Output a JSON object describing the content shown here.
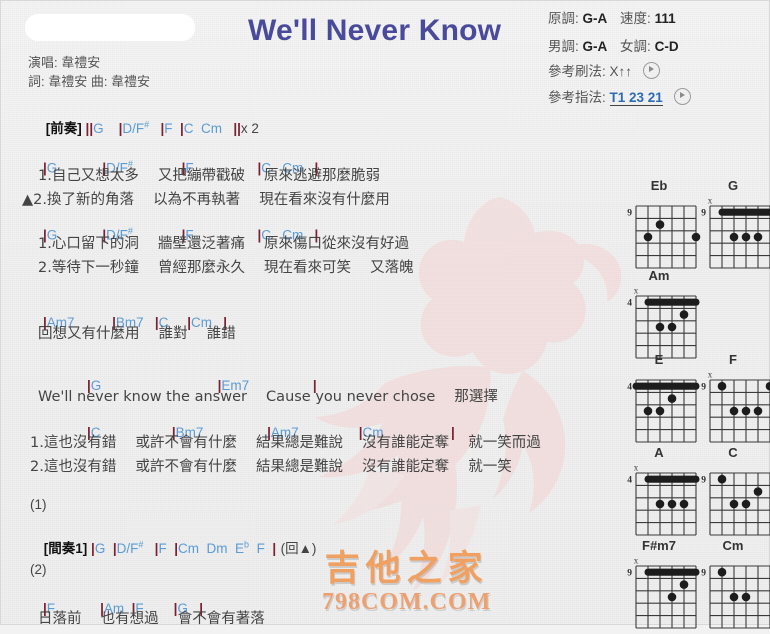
{
  "header": {
    "title": "We'll Never Know",
    "search_placeholder": "",
    "search_value": "",
    "singer_line": "演唱: 韋禮安",
    "credit_line": "詞: 韋禮安   曲: 韋禮安"
  },
  "info": {
    "orig_key_label": "原調:",
    "orig_key_value": "G-A",
    "tempo_label": "速度:",
    "tempo_value": "111",
    "male_key_label": "男調:",
    "male_key_value": "G-A",
    "female_key_label": "女調:",
    "female_key_value": "C-D",
    "strum_label": "參考刷法:",
    "strum_value": "X↑↑",
    "finger_label": "參考指法:",
    "finger_value": "T1 23 21",
    "play_icon": "play-icon"
  },
  "sections": [
    {
      "id": "intro",
      "tag": "[前奏]",
      "chords": "||G    |D/F#    |F    |C    Cm    || x 2"
    }
  ],
  "lines": {
    "intro_tag": "[前奏]",
    "intro_chords_a": "||",
    "intro_G": "G",
    "intro_bar1": "|",
    "intro_DF": "D/F",
    "intro_sharp": "#",
    "intro_bar2": "|",
    "intro_F": "F",
    "intro_bar3": "|",
    "intro_C": "C",
    "intro_Cm": "Cm",
    "intro_end": "||",
    "intro_x2": "x 2",
    "v1_chord_G": "G",
    "v1_chord_DF": "D/F",
    "v1_chord_F": "F",
    "v1_chord_C": "C",
    "v1_chord_Cm": "Cm",
    "v1_lyric_1": "1.自己又想太多　 又把繃帶戳破　 原來逃避那麼脆弱",
    "v1_lyric_2": "▲2.換了新的角落　 以為不再執著　 現在看來沒有什麼用",
    "v2_lyric_1": "1.心口留下的洞　 牆壁還泛著痛　 原來傷口從來沒有好過",
    "v2_lyric_2": "2.等待下一秒鐘　 曾經那麼永久　 現在看來可笑　 又落魄",
    "b1_chord_Am7": "Am7",
    "b1_chord_Bm7": "Bm7",
    "b1_chord_C": "C",
    "b1_chord_Cm": "Cm",
    "b1_lyric": "回想又有什麼用　 誰對　 誰錯",
    "c0_chord_G": "G",
    "c0_chord_Em7": "Em7",
    "c0_lyric": "We'll never know the answer　 Cause you never chose　 那選擇",
    "c1_chord_C": "C",
    "c1_chord_Bm7": "Bm7",
    "c1_chord_Am7": "Am7",
    "c1_chord_Cm": "Cm",
    "c1_lyric_1": "1.這也沒有錯　 或許不會有什麼　 結果總是難說　 沒有誰能定奪　 就一笑而過",
    "c1_lyric_2": "2.這也沒有錯　 或許不會有什麼　 結果總是難說　 沒有誰能定奪　 就一笑",
    "ending1_num": "(1)",
    "interlude_tag": "[間奏1]",
    "i_G": "G",
    "i_DF": "D/F",
    "i_sharp": "#",
    "i_F": "F",
    "i_Cm": "Cm",
    "i_Dm": "Dm",
    "i_E": "E",
    "i_flat": "b",
    "i_F2": "F",
    "i_repeat": "(回▲)",
    "ending2_num": "(2)",
    "e2_chord_F": "F",
    "e2_chord_Am": "Am",
    "e2_chord_F2": "F",
    "e2_chord_G": "G",
    "e2_lyric": "日落前　 也有想過　 會不會有著落",
    "bar": "|"
  },
  "watermark": {
    "cn": "吉他之家",
    "en": "798COM.COM",
    "color": "#f0a060"
  },
  "colors": {
    "title": "#4a4a9c",
    "chord": "#5b9bd5",
    "barline": "#7b2030",
    "lyric": "#444444",
    "watermark": "#f0a060"
  },
  "chord_diagrams": [
    {
      "name": "Eb",
      "base_fret": "9",
      "show_base": true,
      "markers": [
        "",
        "",
        "",
        "",
        "",
        ""
      ],
      "dots": [
        {
          "string": 5,
          "fret": 3
        },
        {
          "string": 4,
          "fret": 2
        },
        {
          "string": 1,
          "fret": 3
        }
      ],
      "barre": null
    },
    {
      "name": "G",
      "base_fret": "9",
      "show_base": true,
      "markers": [
        "x",
        "",
        "",
        "",
        "",
        ""
      ],
      "dots": [
        {
          "string": 4,
          "fret": 3
        },
        {
          "string": 3,
          "fret": 3
        },
        {
          "string": 2,
          "fret": 3
        }
      ],
      "barre": {
        "fret": 1,
        "from": 5,
        "to": 1
      }
    },
    {
      "name": "Am",
      "base_fret": "4",
      "show_base": true,
      "markers": [
        "x",
        "",
        "",
        "",
        "",
        ""
      ],
      "dots": [
        {
          "string": 2,
          "fret": 2
        },
        {
          "string": 4,
          "fret": 3
        },
        {
          "string": 3,
          "fret": 3
        }
      ],
      "barre": {
        "fret": 1,
        "from": 5,
        "to": 1
      }
    },
    {
      "name": "E",
      "base_fret": "4",
      "show_base": true,
      "markers": [
        "",
        "",
        "",
        "",
        "",
        ""
      ],
      "dots": [
        {
          "string": 3,
          "fret": 2
        },
        {
          "string": 5,
          "fret": 3
        },
        {
          "string": 4,
          "fret": 3
        }
      ],
      "barre": {
        "fret": 1,
        "from": 6,
        "to": 1
      }
    },
    {
      "name": "F",
      "base_fret": "9",
      "show_base": true,
      "markers": [
        "x",
        "",
        "",
        "",
        "",
        ""
      ],
      "dots": [
        {
          "string": 5,
          "fret": 1
        },
        {
          "string": 1,
          "fret": 1
        },
        {
          "string": 4,
          "fret": 3
        },
        {
          "string": 3,
          "fret": 3
        },
        {
          "string": 2,
          "fret": 3
        }
      ],
      "barre": null
    },
    {
      "name": "A",
      "base_fret": "4",
      "show_base": true,
      "markers": [
        "x",
        "",
        "",
        "",
        "",
        ""
      ],
      "dots": [
        {
          "string": 4,
          "fret": 3
        },
        {
          "string": 3,
          "fret": 3
        },
        {
          "string": 2,
          "fret": 3
        }
      ],
      "barre": {
        "fret": 1,
        "from": 5,
        "to": 1
      }
    },
    {
      "name": "C",
      "base_fret": "9",
      "show_base": true,
      "markers": [
        "",
        "",
        "",
        "",
        "",
        ""
      ],
      "dots": [
        {
          "string": 5,
          "fret": 1
        },
        {
          "string": 2,
          "fret": 2
        },
        {
          "string": 4,
          "fret": 3
        },
        {
          "string": 3,
          "fret": 3
        }
      ],
      "barre": null
    },
    {
      "name": "F#m7",
      "base_fret": "9",
      "show_base": true,
      "markers": [
        "x",
        "",
        "",
        "",
        "",
        ""
      ],
      "dots": [
        {
          "string": 3,
          "fret": 3
        },
        {
          "string": 2,
          "fret": 2
        }
      ],
      "barre": {
        "fret": 1,
        "from": 5,
        "to": 1
      }
    },
    {
      "name": "Cm",
      "base_fret": "9",
      "show_base": true,
      "markers": [
        "",
        "",
        "",
        "",
        "",
        ""
      ],
      "dots": [
        {
          "string": 5,
          "fret": 1
        },
        {
          "string": 4,
          "fret": 3
        },
        {
          "string": 3,
          "fret": 3
        }
      ],
      "barre": null
    }
  ]
}
